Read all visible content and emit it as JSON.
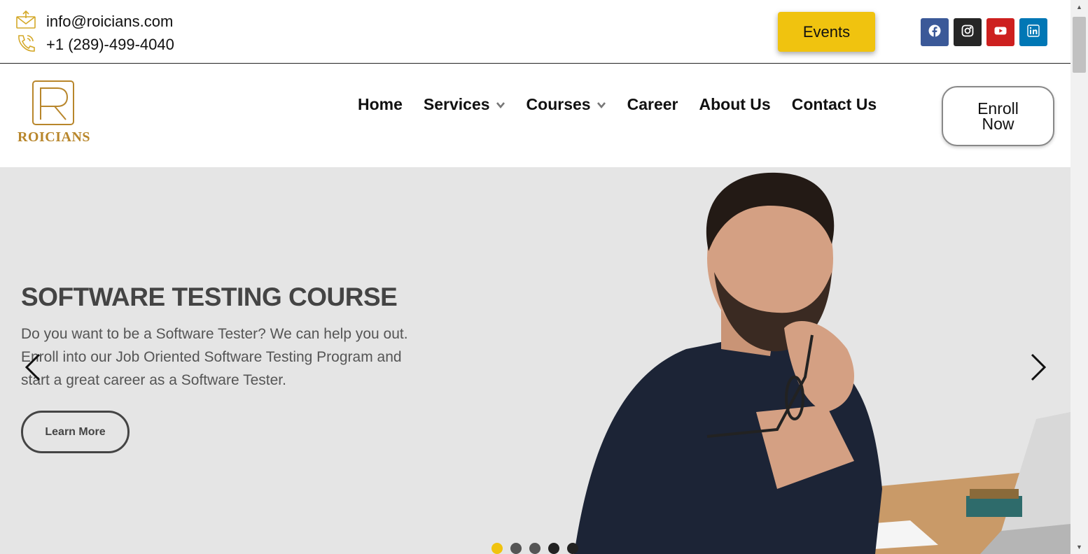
{
  "contact": {
    "email": "info@roicians.com",
    "phone": "+1 (289)-499-4040",
    "email_icon": "envelope-upload-icon",
    "phone_icon": "phone-ringing-icon"
  },
  "header": {
    "events_label": "Events",
    "accent_color": "#f0c30f",
    "socials": [
      {
        "name": "facebook",
        "icon": "facebook-icon",
        "color": "#3b5998"
      },
      {
        "name": "instagram",
        "icon": "instagram-icon",
        "color": "#262626"
      },
      {
        "name": "youtube",
        "icon": "youtube-icon",
        "color": "#cd201f"
      },
      {
        "name": "linkedin",
        "icon": "linkedin-icon",
        "color": "#0077b5"
      }
    ]
  },
  "brand": {
    "logo_text": "ROICIANS",
    "logo_color": "#b8862b"
  },
  "nav": {
    "items": [
      {
        "label": "Home",
        "has_dropdown": false
      },
      {
        "label": "Services",
        "has_dropdown": true
      },
      {
        "label": "Courses",
        "has_dropdown": true
      },
      {
        "label": "Career",
        "has_dropdown": false
      },
      {
        "label": "About Us",
        "has_dropdown": false
      },
      {
        "label": "Contact Us",
        "has_dropdown": false
      }
    ],
    "enroll_line1": "Enroll",
    "enroll_line2": "Now"
  },
  "hero": {
    "title": "SOFTWARE TESTING COURSE",
    "description": "Do you want to be a Software Tester? We can help you out. Enroll into our Job Oriented Software Testing Program and start a great career as a Software Tester.",
    "cta_label": "Learn More",
    "slide_count": 5,
    "active_slide": 1
  }
}
